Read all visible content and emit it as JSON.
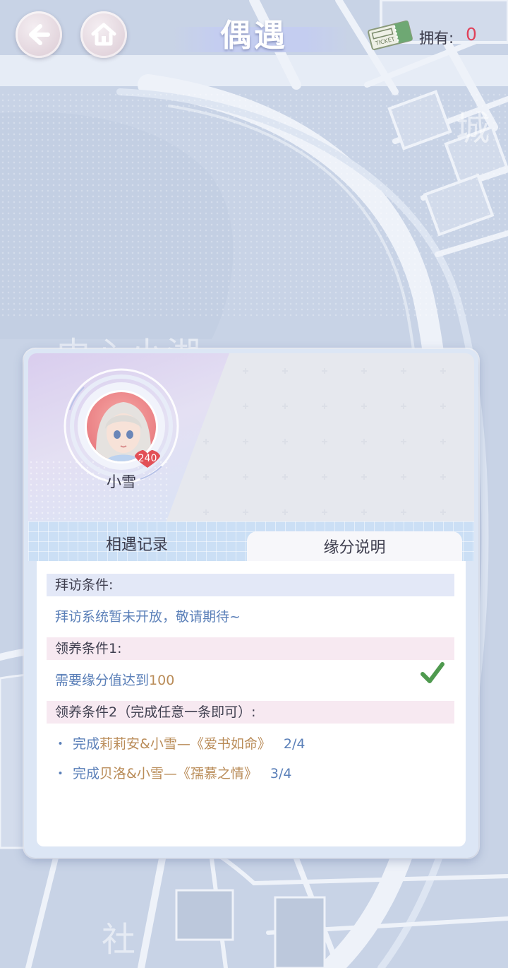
{
  "topbar": {
    "title": "偶遇",
    "own_label": "拥有:",
    "own_count": "0"
  },
  "map": {
    "labels": [
      "城",
      "中心小湖",
      "社"
    ]
  },
  "character": {
    "name": "小雪",
    "level": "240"
  },
  "tabs": {
    "record": "相遇记录",
    "explain": "缘分说明"
  },
  "sections": {
    "visit_head": "拜访条件:",
    "visit_text": "拜访系统暂未开放，敬请期待~",
    "adopt1_head": "领养条件1:",
    "adopt1_text_pre": "需要缘分值达到",
    "adopt1_text_num": "100",
    "adopt2_head": "领养条件2（完成任意一条即可）:",
    "items": [
      {
        "bullet": "・",
        "pre": "完成",
        "pair": "莉莉安&小雪—《爱书如命》",
        "progress": "2/4"
      },
      {
        "bullet": "・",
        "pre": "完成",
        "pair": "贝洛&小雪—《孺慕之情》",
        "progress": "3/4"
      }
    ]
  },
  "colors": {
    "map_bg": "#c9d4e6",
    "accent_blue": "#5a7fb8",
    "accent_gold": "#b98b57",
    "count_red": "#e0425a",
    "check_green": "#4f9a4f"
  }
}
